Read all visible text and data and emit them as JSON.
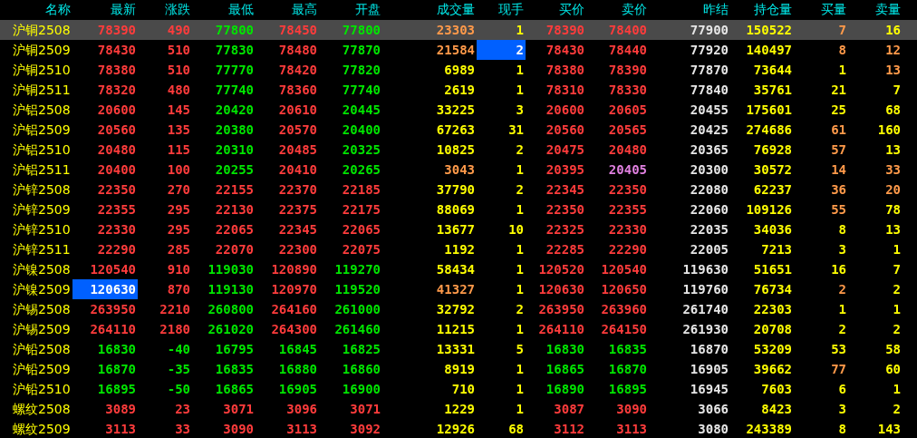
{
  "table": {
    "columns": [
      "名称",
      "最新",
      "涨跌",
      "最低",
      "最高",
      "开盘",
      "成交量",
      "现手",
      "买价",
      "卖价",
      "昨结",
      "持仓量",
      "买量",
      "卖量"
    ],
    "rows": [
      {
        "selected": true,
        "cells": [
          {
            "text": "沪铜2508",
            "color": "#ffff00"
          },
          {
            "text": "78390",
            "color": "#ff3c3c"
          },
          {
            "text": "490",
            "color": "#ff3c3c"
          },
          {
            "text": "77800",
            "color": "#00e600"
          },
          {
            "text": "78450",
            "color": "#ff3c3c"
          },
          {
            "text": "77800",
            "color": "#00e600"
          },
          {
            "text": "23303",
            "color": "#ff9a4a"
          },
          {
            "text": "1",
            "color": "#ffff00"
          },
          {
            "text": "78390",
            "color": "#ff3c3c"
          },
          {
            "text": "78400",
            "color": "#ff3c3c"
          },
          {
            "text": "77900",
            "color": "#e6e6e6"
          },
          {
            "text": "150522",
            "color": "#ffff00"
          },
          {
            "text": "7",
            "color": "#ff9a4a"
          },
          {
            "text": "16",
            "color": "#ffff00"
          }
        ]
      },
      {
        "selected": false,
        "cells": [
          {
            "text": "沪铜2509",
            "color": "#ffff00"
          },
          {
            "text": "78430",
            "color": "#ff3c3c"
          },
          {
            "text": "510",
            "color": "#ff3c3c"
          },
          {
            "text": "77830",
            "color": "#00e600"
          },
          {
            "text": "78480",
            "color": "#ff3c3c"
          },
          {
            "text": "77870",
            "color": "#00e600"
          },
          {
            "text": "21584",
            "color": "#ff9a4a"
          },
          {
            "text": "2",
            "color": "#ffffff",
            "highlighted": true
          },
          {
            "text": "78430",
            "color": "#ff3c3c"
          },
          {
            "text": "78440",
            "color": "#ff3c3c"
          },
          {
            "text": "77920",
            "color": "#e6e6e6"
          },
          {
            "text": "140497",
            "color": "#ffff00"
          },
          {
            "text": "8",
            "color": "#ff9a4a"
          },
          {
            "text": "12",
            "color": "#ff9a4a"
          }
        ]
      },
      {
        "selected": false,
        "cells": [
          {
            "text": "沪铜2510",
            "color": "#ffff00"
          },
          {
            "text": "78380",
            "color": "#ff3c3c"
          },
          {
            "text": "510",
            "color": "#ff3c3c"
          },
          {
            "text": "77770",
            "color": "#00e600"
          },
          {
            "text": "78420",
            "color": "#ff3c3c"
          },
          {
            "text": "77820",
            "color": "#00e600"
          },
          {
            "text": "6989",
            "color": "#ffff00"
          },
          {
            "text": "1",
            "color": "#ffff00"
          },
          {
            "text": "78380",
            "color": "#ff3c3c"
          },
          {
            "text": "78390",
            "color": "#ff3c3c"
          },
          {
            "text": "77870",
            "color": "#e6e6e6"
          },
          {
            "text": "73644",
            "color": "#ffff00"
          },
          {
            "text": "1",
            "color": "#ffff00"
          },
          {
            "text": "13",
            "color": "#ff9a4a"
          }
        ]
      },
      {
        "selected": false,
        "cells": [
          {
            "text": "沪铜2511",
            "color": "#ffff00"
          },
          {
            "text": "78320",
            "color": "#ff3c3c"
          },
          {
            "text": "480",
            "color": "#ff3c3c"
          },
          {
            "text": "77740",
            "color": "#00e600"
          },
          {
            "text": "78360",
            "color": "#ff3c3c"
          },
          {
            "text": "77740",
            "color": "#00e600"
          },
          {
            "text": "2619",
            "color": "#ffff00"
          },
          {
            "text": "1",
            "color": "#ffff00"
          },
          {
            "text": "78310",
            "color": "#ff3c3c"
          },
          {
            "text": "78330",
            "color": "#ff3c3c"
          },
          {
            "text": "77840",
            "color": "#e6e6e6"
          },
          {
            "text": "35761",
            "color": "#ffff00"
          },
          {
            "text": "21",
            "color": "#ffff00"
          },
          {
            "text": "7",
            "color": "#ffff00"
          }
        ]
      },
      {
        "selected": false,
        "cells": [
          {
            "text": "沪铝2508",
            "color": "#ffff00"
          },
          {
            "text": "20600",
            "color": "#ff3c3c"
          },
          {
            "text": "145",
            "color": "#ff3c3c"
          },
          {
            "text": "20420",
            "color": "#00e600"
          },
          {
            "text": "20610",
            "color": "#ff3c3c"
          },
          {
            "text": "20445",
            "color": "#00e600"
          },
          {
            "text": "33225",
            "color": "#ffff00"
          },
          {
            "text": "3",
            "color": "#ffff00"
          },
          {
            "text": "20600",
            "color": "#ff3c3c"
          },
          {
            "text": "20605",
            "color": "#ff3c3c"
          },
          {
            "text": "20455",
            "color": "#e6e6e6"
          },
          {
            "text": "175601",
            "color": "#ffff00"
          },
          {
            "text": "25",
            "color": "#ffff00"
          },
          {
            "text": "68",
            "color": "#ffff00"
          }
        ]
      },
      {
        "selected": false,
        "cells": [
          {
            "text": "沪铝2509",
            "color": "#ffff00"
          },
          {
            "text": "20560",
            "color": "#ff3c3c"
          },
          {
            "text": "135",
            "color": "#ff3c3c"
          },
          {
            "text": "20380",
            "color": "#00e600"
          },
          {
            "text": "20570",
            "color": "#ff3c3c"
          },
          {
            "text": "20400",
            "color": "#00e600"
          },
          {
            "text": "67263",
            "color": "#ffff00"
          },
          {
            "text": "31",
            "color": "#ffff00"
          },
          {
            "text": "20560",
            "color": "#ff3c3c"
          },
          {
            "text": "20565",
            "color": "#ff3c3c"
          },
          {
            "text": "20425",
            "color": "#e6e6e6"
          },
          {
            "text": "274686",
            "color": "#ffff00"
          },
          {
            "text": "61",
            "color": "#ff9a4a"
          },
          {
            "text": "160",
            "color": "#ffff00"
          }
        ]
      },
      {
        "selected": false,
        "cells": [
          {
            "text": "沪铝2510",
            "color": "#ffff00"
          },
          {
            "text": "20480",
            "color": "#ff3c3c"
          },
          {
            "text": "115",
            "color": "#ff3c3c"
          },
          {
            "text": "20310",
            "color": "#00e600"
          },
          {
            "text": "20485",
            "color": "#ff3c3c"
          },
          {
            "text": "20325",
            "color": "#00e600"
          },
          {
            "text": "10825",
            "color": "#ffff00"
          },
          {
            "text": "2",
            "color": "#ffff00"
          },
          {
            "text": "20475",
            "color": "#ff3c3c"
          },
          {
            "text": "20480",
            "color": "#ff3c3c"
          },
          {
            "text": "20365",
            "color": "#e6e6e6"
          },
          {
            "text": "76928",
            "color": "#ffff00"
          },
          {
            "text": "57",
            "color": "#ff9a4a"
          },
          {
            "text": "13",
            "color": "#ffff00"
          }
        ]
      },
      {
        "selected": false,
        "cells": [
          {
            "text": "沪铝2511",
            "color": "#ffff00"
          },
          {
            "text": "20400",
            "color": "#ff3c3c"
          },
          {
            "text": "100",
            "color": "#ff3c3c"
          },
          {
            "text": "20255",
            "color": "#00e600"
          },
          {
            "text": "20410",
            "color": "#ff3c3c"
          },
          {
            "text": "20265",
            "color": "#00e600"
          },
          {
            "text": "3043",
            "color": "#ff9a4a"
          },
          {
            "text": "1",
            "color": "#ffff00"
          },
          {
            "text": "20395",
            "color": "#ff3c3c"
          },
          {
            "text": "20405",
            "color": "#e080e0"
          },
          {
            "text": "20300",
            "color": "#e6e6e6"
          },
          {
            "text": "30572",
            "color": "#ffff00"
          },
          {
            "text": "14",
            "color": "#ff9a4a"
          },
          {
            "text": "33",
            "color": "#ff9a4a"
          }
        ]
      },
      {
        "selected": false,
        "cells": [
          {
            "text": "沪锌2508",
            "color": "#ffff00"
          },
          {
            "text": "22350",
            "color": "#ff3c3c"
          },
          {
            "text": "270",
            "color": "#ff3c3c"
          },
          {
            "text": "22155",
            "color": "#ff3c3c"
          },
          {
            "text": "22370",
            "color": "#ff3c3c"
          },
          {
            "text": "22185",
            "color": "#ff3c3c"
          },
          {
            "text": "37790",
            "color": "#ffff00"
          },
          {
            "text": "2",
            "color": "#ffff00"
          },
          {
            "text": "22345",
            "color": "#ff3c3c"
          },
          {
            "text": "22350",
            "color": "#ff3c3c"
          },
          {
            "text": "22080",
            "color": "#e6e6e6"
          },
          {
            "text": "62237",
            "color": "#ffff00"
          },
          {
            "text": "36",
            "color": "#ff9a4a"
          },
          {
            "text": "20",
            "color": "#ff9a4a"
          }
        ]
      },
      {
        "selected": false,
        "cells": [
          {
            "text": "沪锌2509",
            "color": "#ffff00"
          },
          {
            "text": "22355",
            "color": "#ff3c3c"
          },
          {
            "text": "295",
            "color": "#ff3c3c"
          },
          {
            "text": "22130",
            "color": "#ff3c3c"
          },
          {
            "text": "22375",
            "color": "#ff3c3c"
          },
          {
            "text": "22175",
            "color": "#ff3c3c"
          },
          {
            "text": "88069",
            "color": "#ffff00"
          },
          {
            "text": "1",
            "color": "#ffff00"
          },
          {
            "text": "22350",
            "color": "#ff3c3c"
          },
          {
            "text": "22355",
            "color": "#ff3c3c"
          },
          {
            "text": "22060",
            "color": "#e6e6e6"
          },
          {
            "text": "109126",
            "color": "#ffff00"
          },
          {
            "text": "55",
            "color": "#ff9a4a"
          },
          {
            "text": "78",
            "color": "#ffff00"
          }
        ]
      },
      {
        "selected": false,
        "cells": [
          {
            "text": "沪锌2510",
            "color": "#ffff00"
          },
          {
            "text": "22330",
            "color": "#ff3c3c"
          },
          {
            "text": "295",
            "color": "#ff3c3c"
          },
          {
            "text": "22065",
            "color": "#ff3c3c"
          },
          {
            "text": "22345",
            "color": "#ff3c3c"
          },
          {
            "text": "22065",
            "color": "#ff3c3c"
          },
          {
            "text": "13677",
            "color": "#ffff00"
          },
          {
            "text": "10",
            "color": "#ffff00"
          },
          {
            "text": "22325",
            "color": "#ff3c3c"
          },
          {
            "text": "22330",
            "color": "#ff3c3c"
          },
          {
            "text": "22035",
            "color": "#e6e6e6"
          },
          {
            "text": "34036",
            "color": "#ffff00"
          },
          {
            "text": "8",
            "color": "#ffff00"
          },
          {
            "text": "13",
            "color": "#ffff00"
          }
        ]
      },
      {
        "selected": false,
        "cells": [
          {
            "text": "沪锌2511",
            "color": "#ffff00"
          },
          {
            "text": "22290",
            "color": "#ff3c3c"
          },
          {
            "text": "285",
            "color": "#ff3c3c"
          },
          {
            "text": "22070",
            "color": "#ff3c3c"
          },
          {
            "text": "22300",
            "color": "#ff3c3c"
          },
          {
            "text": "22075",
            "color": "#ff3c3c"
          },
          {
            "text": "1192",
            "color": "#ffff00"
          },
          {
            "text": "1",
            "color": "#ffff00"
          },
          {
            "text": "22285",
            "color": "#ff3c3c"
          },
          {
            "text": "22290",
            "color": "#ff3c3c"
          },
          {
            "text": "22005",
            "color": "#e6e6e6"
          },
          {
            "text": "7213",
            "color": "#ffff00"
          },
          {
            "text": "3",
            "color": "#ffff00"
          },
          {
            "text": "1",
            "color": "#ffff00"
          }
        ]
      },
      {
        "selected": false,
        "cells": [
          {
            "text": "沪镍2508",
            "color": "#ffff00"
          },
          {
            "text": "120540",
            "color": "#ff3c3c"
          },
          {
            "text": "910",
            "color": "#ff3c3c"
          },
          {
            "text": "119030",
            "color": "#00e600"
          },
          {
            "text": "120890",
            "color": "#ff3c3c"
          },
          {
            "text": "119270",
            "color": "#00e600"
          },
          {
            "text": "58434",
            "color": "#ffff00"
          },
          {
            "text": "1",
            "color": "#ffff00"
          },
          {
            "text": "120520",
            "color": "#ff3c3c"
          },
          {
            "text": "120540",
            "color": "#ff3c3c"
          },
          {
            "text": "119630",
            "color": "#e6e6e6"
          },
          {
            "text": "51651",
            "color": "#ffff00"
          },
          {
            "text": "16",
            "color": "#ffff00"
          },
          {
            "text": "7",
            "color": "#ffff00"
          }
        ]
      },
      {
        "selected": false,
        "cells": [
          {
            "text": "沪镍2509",
            "color": "#ffff00"
          },
          {
            "text": "120630",
            "color": "#ffffff",
            "highlighted": true
          },
          {
            "text": "870",
            "color": "#ff3c3c"
          },
          {
            "text": "119130",
            "color": "#00e600"
          },
          {
            "text": "120970",
            "color": "#ff3c3c"
          },
          {
            "text": "119520",
            "color": "#00e600"
          },
          {
            "text": "41327",
            "color": "#ff9a4a"
          },
          {
            "text": "1",
            "color": "#ffff00"
          },
          {
            "text": "120630",
            "color": "#ff3c3c"
          },
          {
            "text": "120650",
            "color": "#ff3c3c"
          },
          {
            "text": "119760",
            "color": "#e6e6e6"
          },
          {
            "text": "76734",
            "color": "#ffff00"
          },
          {
            "text": "2",
            "color": "#ff9a4a"
          },
          {
            "text": "2",
            "color": "#ffff00"
          }
        ]
      },
      {
        "selected": false,
        "cells": [
          {
            "text": "沪锡2508",
            "color": "#ffff00"
          },
          {
            "text": "263950",
            "color": "#ff3c3c"
          },
          {
            "text": "2210",
            "color": "#ff3c3c"
          },
          {
            "text": "260800",
            "color": "#00e600"
          },
          {
            "text": "264160",
            "color": "#ff3c3c"
          },
          {
            "text": "261000",
            "color": "#00e600"
          },
          {
            "text": "32792",
            "color": "#ffff00"
          },
          {
            "text": "2",
            "color": "#ffff00"
          },
          {
            "text": "263950",
            "color": "#ff3c3c"
          },
          {
            "text": "263960",
            "color": "#ff3c3c"
          },
          {
            "text": "261740",
            "color": "#e6e6e6"
          },
          {
            "text": "22303",
            "color": "#ffff00"
          },
          {
            "text": "1",
            "color": "#ffff00"
          },
          {
            "text": "1",
            "color": "#ffff00"
          }
        ]
      },
      {
        "selected": false,
        "cells": [
          {
            "text": "沪锡2509",
            "color": "#ffff00"
          },
          {
            "text": "264110",
            "color": "#ff3c3c"
          },
          {
            "text": "2180",
            "color": "#ff3c3c"
          },
          {
            "text": "261020",
            "color": "#00e600"
          },
          {
            "text": "264300",
            "color": "#ff3c3c"
          },
          {
            "text": "261460",
            "color": "#00e600"
          },
          {
            "text": "11215",
            "color": "#ffff00"
          },
          {
            "text": "1",
            "color": "#ffff00"
          },
          {
            "text": "264110",
            "color": "#ff3c3c"
          },
          {
            "text": "264150",
            "color": "#ff3c3c"
          },
          {
            "text": "261930",
            "color": "#e6e6e6"
          },
          {
            "text": "20708",
            "color": "#ffff00"
          },
          {
            "text": "2",
            "color": "#ffff00"
          },
          {
            "text": "2",
            "color": "#ffff00"
          }
        ]
      },
      {
        "selected": false,
        "cells": [
          {
            "text": "沪铅2508",
            "color": "#ffff00"
          },
          {
            "text": "16830",
            "color": "#00e600"
          },
          {
            "text": "-40",
            "color": "#00e600"
          },
          {
            "text": "16795",
            "color": "#00e600"
          },
          {
            "text": "16845",
            "color": "#00e600"
          },
          {
            "text": "16825",
            "color": "#00e600"
          },
          {
            "text": "13331",
            "color": "#ffff00"
          },
          {
            "text": "5",
            "color": "#ffff00"
          },
          {
            "text": "16830",
            "color": "#00e600"
          },
          {
            "text": "16835",
            "color": "#00e600"
          },
          {
            "text": "16870",
            "color": "#e6e6e6"
          },
          {
            "text": "53209",
            "color": "#ffff00"
          },
          {
            "text": "53",
            "color": "#ffff00"
          },
          {
            "text": "58",
            "color": "#ffff00"
          }
        ]
      },
      {
        "selected": false,
        "cells": [
          {
            "text": "沪铅2509",
            "color": "#ffff00"
          },
          {
            "text": "16870",
            "color": "#00e600"
          },
          {
            "text": "-35",
            "color": "#00e600"
          },
          {
            "text": "16835",
            "color": "#00e600"
          },
          {
            "text": "16880",
            "color": "#00e600"
          },
          {
            "text": "16860",
            "color": "#00e600"
          },
          {
            "text": "8919",
            "color": "#ffff00"
          },
          {
            "text": "1",
            "color": "#ffff00"
          },
          {
            "text": "16865",
            "color": "#00e600"
          },
          {
            "text": "16870",
            "color": "#00e600"
          },
          {
            "text": "16905",
            "color": "#e6e6e6"
          },
          {
            "text": "39662",
            "color": "#ffff00"
          },
          {
            "text": "77",
            "color": "#ff9a4a"
          },
          {
            "text": "60",
            "color": "#ffff00"
          }
        ]
      },
      {
        "selected": false,
        "cells": [
          {
            "text": "沪铅2510",
            "color": "#ffff00"
          },
          {
            "text": "16895",
            "color": "#00e600"
          },
          {
            "text": "-50",
            "color": "#00e600"
          },
          {
            "text": "16865",
            "color": "#00e600"
          },
          {
            "text": "16905",
            "color": "#00e600"
          },
          {
            "text": "16900",
            "color": "#00e600"
          },
          {
            "text": "710",
            "color": "#ffff00"
          },
          {
            "text": "1",
            "color": "#ffff00"
          },
          {
            "text": "16890",
            "color": "#00e600"
          },
          {
            "text": "16895",
            "color": "#00e600"
          },
          {
            "text": "16945",
            "color": "#e6e6e6"
          },
          {
            "text": "7603",
            "color": "#ffff00"
          },
          {
            "text": "6",
            "color": "#ffff00"
          },
          {
            "text": "1",
            "color": "#ffff00"
          }
        ]
      },
      {
        "selected": false,
        "cells": [
          {
            "text": "螺纹2508",
            "color": "#ffff00"
          },
          {
            "text": "3089",
            "color": "#ff3c3c"
          },
          {
            "text": "23",
            "color": "#ff3c3c"
          },
          {
            "text": "3071",
            "color": "#ff3c3c"
          },
          {
            "text": "3096",
            "color": "#ff3c3c"
          },
          {
            "text": "3071",
            "color": "#ff3c3c"
          },
          {
            "text": "1229",
            "color": "#ffff00"
          },
          {
            "text": "1",
            "color": "#ffff00"
          },
          {
            "text": "3087",
            "color": "#ff3c3c"
          },
          {
            "text": "3090",
            "color": "#ff3c3c"
          },
          {
            "text": "3066",
            "color": "#e6e6e6"
          },
          {
            "text": "8423",
            "color": "#ffff00"
          },
          {
            "text": "3",
            "color": "#ffff00"
          },
          {
            "text": "2",
            "color": "#ffff00"
          }
        ]
      },
      {
        "selected": false,
        "cells": [
          {
            "text": "螺纹2509",
            "color": "#ffff00"
          },
          {
            "text": "3113",
            "color": "#ff3c3c"
          },
          {
            "text": "33",
            "color": "#ff3c3c"
          },
          {
            "text": "3090",
            "color": "#ff3c3c"
          },
          {
            "text": "3113",
            "color": "#ff3c3c"
          },
          {
            "text": "3092",
            "color": "#ff3c3c"
          },
          {
            "text": "12926",
            "color": "#ffff00"
          },
          {
            "text": "68",
            "color": "#ffff00"
          },
          {
            "text": "3112",
            "color": "#ff3c3c"
          },
          {
            "text": "3113",
            "color": "#ff3c3c"
          },
          {
            "text": "3080",
            "color": "#e6e6e6"
          },
          {
            "text": "243389",
            "color": "#ffff00"
          },
          {
            "text": "8",
            "color": "#ffff00"
          },
          {
            "text": "143",
            "color": "#ffff00"
          }
        ]
      }
    ]
  }
}
